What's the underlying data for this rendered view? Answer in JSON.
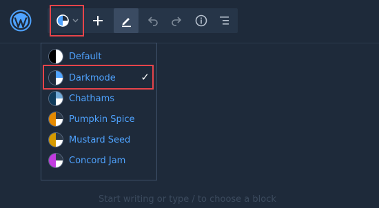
{
  "colors": {
    "background": "#1e2a3a",
    "accent_text": "#4fa3ff",
    "highlight": "#e8444a"
  },
  "toolbar": {
    "icons": [
      "wordpress-logo",
      "theme-switcher-icon",
      "chevron-down-icon",
      "plus-icon",
      "pencil-icon",
      "undo-icon",
      "redo-icon",
      "info-icon",
      "list-view-icon"
    ]
  },
  "dropdown": {
    "items": [
      {
        "label": "Default",
        "colors": [
          "#000000",
          "#ffffff"
        ],
        "checked": false
      },
      {
        "label": "Darkmode",
        "colors": [
          "#1e2a3a",
          "#4fa3ff"
        ],
        "checked": true
      },
      {
        "label": "Chathams",
        "colors": [
          "#0f3a5a",
          "#6fa8d6"
        ],
        "checked": false
      },
      {
        "label": "Pumpkin Spice",
        "colors": [
          "#e58a00",
          "#2d3a4a"
        ],
        "checked": false
      },
      {
        "label": "Mustard Seed",
        "colors": [
          "#d69a00",
          "#2d3a4a"
        ],
        "checked": false
      },
      {
        "label": "Concord Jam",
        "colors": [
          "#c23be0",
          "#2d3a4a"
        ],
        "checked": false
      }
    ],
    "check_mark": "✓"
  },
  "editor": {
    "placeholder": "Start writing or type / to choose a block"
  }
}
